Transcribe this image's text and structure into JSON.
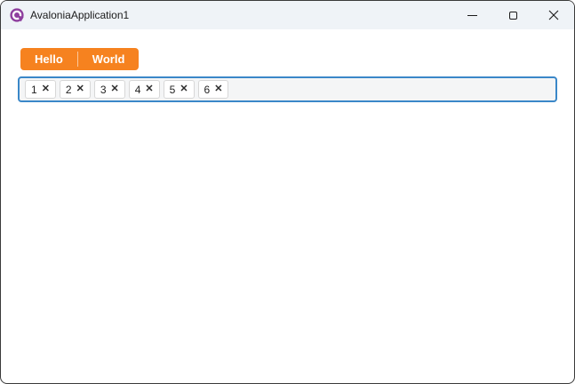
{
  "window": {
    "title": "AvaloniaApplication1",
    "titlebar_bg": "#EFF3F7",
    "border_color": "#3A3A3A",
    "icons": {
      "app_logo": "avalonia-logo-icon",
      "logo_color": "#8E3F9E",
      "minimize": "minimize-icon",
      "maximize": "maximize-icon",
      "close": "close-icon"
    }
  },
  "split_button": {
    "accent_color": "#F6821F",
    "buttons": [
      {
        "label": "Hello"
      },
      {
        "label": "World"
      }
    ]
  },
  "tags_input": {
    "focus_border_color": "#3A87C8",
    "background": "#F4F5F6",
    "remove_icon": "✕",
    "items": [
      {
        "label": "1"
      },
      {
        "label": "2"
      },
      {
        "label": "3"
      },
      {
        "label": "4"
      },
      {
        "label": "5"
      },
      {
        "label": "6"
      }
    ]
  }
}
